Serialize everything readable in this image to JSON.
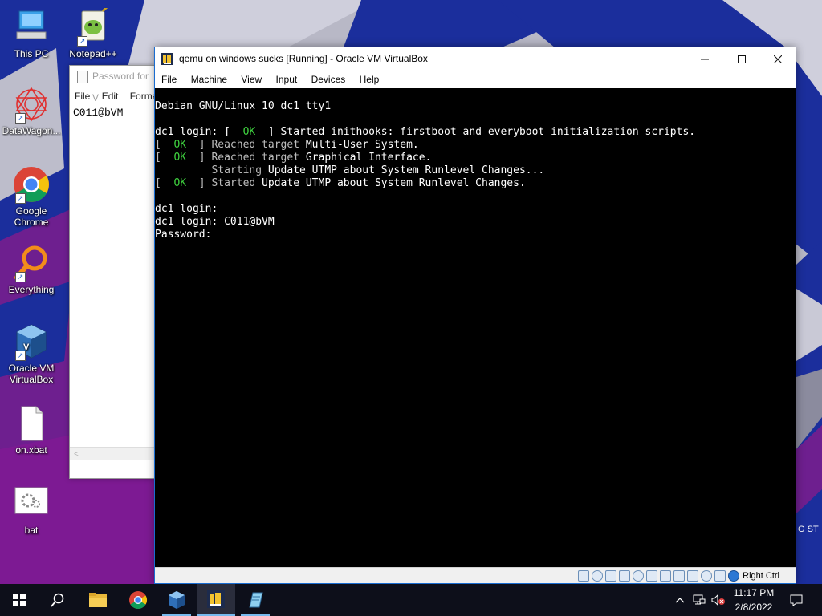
{
  "desktop": {
    "icons": [
      {
        "label": "This PC",
        "icon": "this-pc-icon"
      },
      {
        "label": "Notepad++",
        "icon": "notepadpp-icon"
      },
      {
        "label": "DataWagon...",
        "icon": "datawagon-icon"
      },
      {
        "label": "Google Chrome",
        "icon": "chrome-icon"
      },
      {
        "label": "Everything",
        "icon": "everything-search-icon"
      },
      {
        "label": "Oracle VM VirtualBox",
        "icon": "virtualbox-icon"
      },
      {
        "label": "on.xbat",
        "icon": "file-icon"
      },
      {
        "label": "bat",
        "icon": "batch-file-icon"
      }
    ],
    "wallpaper_edge_text": "G ST"
  },
  "notepad": {
    "title": "Password for V",
    "menu": {
      "file": "File",
      "edit": "Edit",
      "format": "Forma"
    },
    "content": "C011@bVM",
    "hscroll_arrow": "<"
  },
  "virtualbox": {
    "title": "qemu on windows sucks [Running] - Oracle VM VirtualBox",
    "menu": [
      "File",
      "Machine",
      "View",
      "Input",
      "Devices",
      "Help"
    ],
    "console": {
      "banner": "Debian GNU/Linux 10 dc1 tty1",
      "boot_line_prefix": "dc1 login: [  ",
      "ok": "OK",
      "boot_line_rest": "  ] Started ",
      "boot_line_unit": "inithooks: firstboot and everyboot initialization scripts.",
      "msg2_pre": "[  ",
      "msg2_post": "  ] Reached target ",
      "msg2_unit": "Multi-User System.",
      "msg3_unit": "Graphical Interface.",
      "msg4_pre": "         Starting ",
      "msg4_unit": "Update UTMP about System Runlevel Changes...",
      "msg5_post": "  ] Started ",
      "msg5_unit": "Update UTMP about System Runlevel Changes.",
      "login_empty": "dc1 login:",
      "login_user": "dc1 login: C011@bVM",
      "password_prompt": "Password:"
    },
    "status": {
      "host_key": "Right Ctrl",
      "indicators": [
        "hard-disk-icon",
        "optical-drive-icon",
        "audio-icon",
        "network-icon",
        "usb-icon",
        "shared-folders-icon",
        "display-icon",
        "video-capture-icon",
        "cpu-icon",
        "mouse-integration-icon",
        "keyboard-icon"
      ]
    }
  },
  "taskbar": {
    "clock_time": "11:17 PM",
    "clock_date": "2/8/2022"
  }
}
